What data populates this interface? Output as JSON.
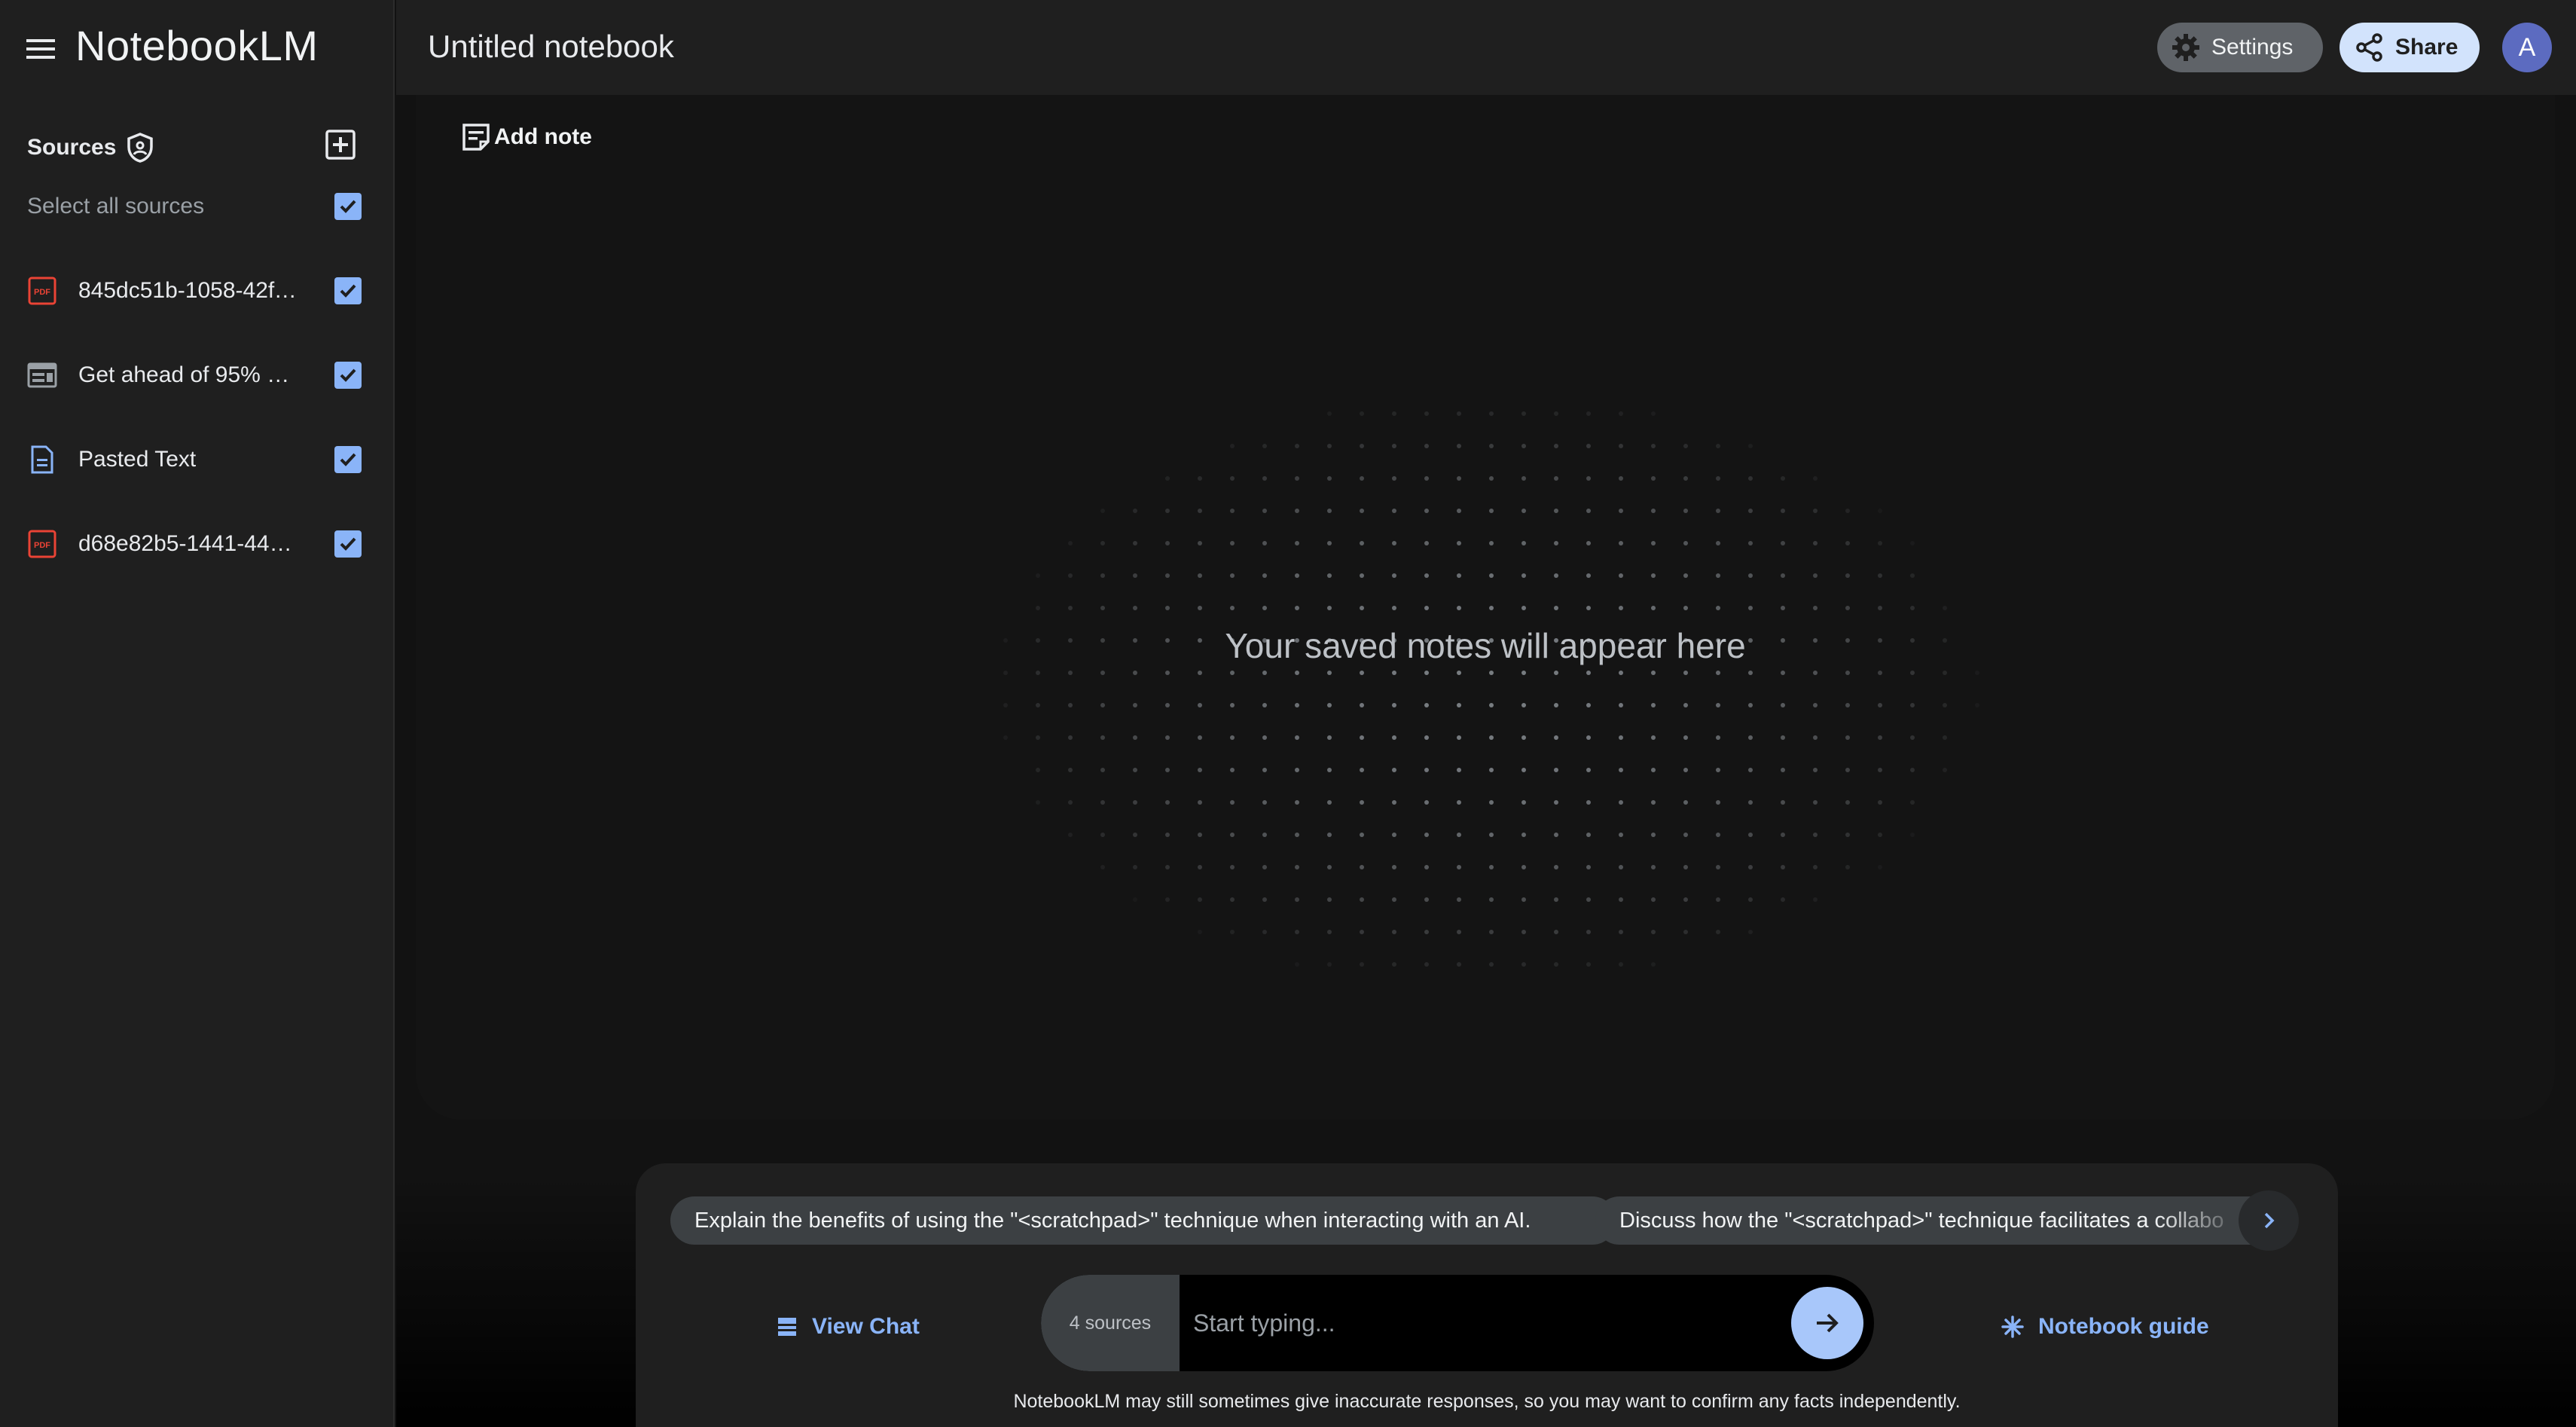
{
  "app": {
    "brand": "NotebookLM"
  },
  "sidebar": {
    "sources_title": "Sources",
    "select_all_label": "Select all sources",
    "select_all_checked": true,
    "items": [
      {
        "label": "845dc51b-1058-42ff-...",
        "icon": "pdf-icon",
        "checked": true
      },
      {
        "label": "Get ahead of 95% of ...",
        "icon": "webpage-icon",
        "checked": true
      },
      {
        "label": "Pasted Text",
        "icon": "text-document-icon",
        "checked": true
      },
      {
        "label": "d68e82b5-1441-44e5...",
        "icon": "pdf-icon",
        "checked": true
      }
    ]
  },
  "header": {
    "title": "Untitled notebook",
    "settings_label": "Settings",
    "share_label": "Share",
    "avatar_initial": "A"
  },
  "notes": {
    "add_note_label": "Add note",
    "empty_message": "Your saved notes will appear here"
  },
  "chat": {
    "suggestions": [
      "Explain the benefits of using the \"<scratchpad>\" technique when interacting with an AI.",
      "Discuss how the \"<scratchpad>\" technique facilitates a collabo"
    ],
    "view_chat_label": "View Chat",
    "sources_count": "4 sources",
    "input_placeholder": "Start typing...",
    "notebook_guide_label": "Notebook guide",
    "disclaimer": "NotebookLM may still sometimes give inaccurate responses, so you may want to confirm any facts independently."
  },
  "colors": {
    "accent": "#8ab4f8",
    "share_bg": "#d2e3fc",
    "avatar_bg": "#5c6bc0",
    "pdf_red": "#ea4335"
  }
}
